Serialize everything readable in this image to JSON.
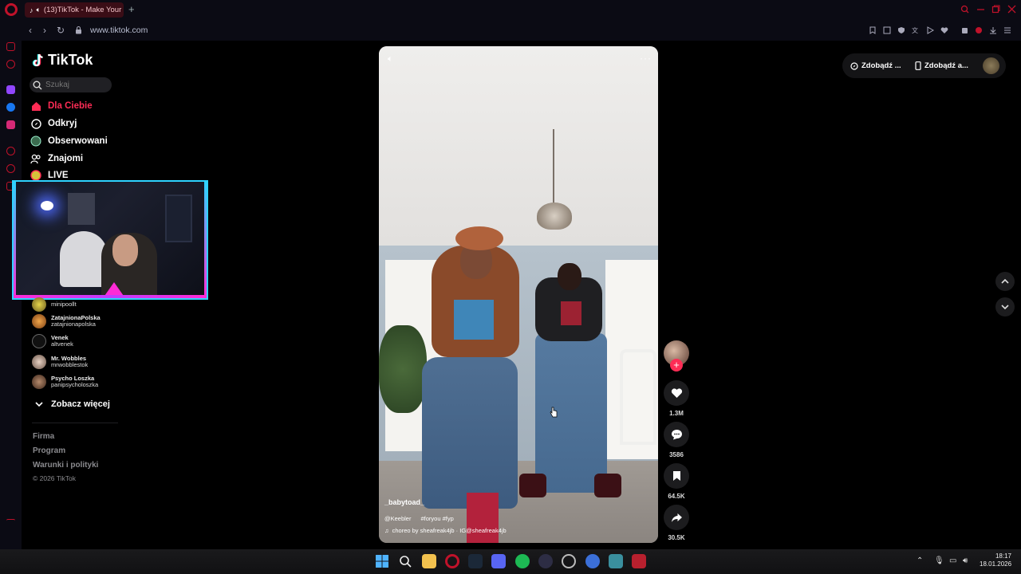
{
  "browser": {
    "tab_title": "(13)TikTok - Make Your",
    "new_tab": "+",
    "url": "www.tiktok.com"
  },
  "tiktok": {
    "logo_text": "TikTok",
    "search_placeholder": "Szukaj",
    "nav": [
      {
        "label": "Dla Ciebie",
        "icon": "home-icon",
        "active": true
      },
      {
        "label": "Odkryj",
        "icon": "compass-icon",
        "active": false
      },
      {
        "label": "Obserwowani",
        "icon": "following-avatar-icon",
        "active": false
      },
      {
        "label": "Znajomi",
        "icon": "friends-icon",
        "active": false
      },
      {
        "label": "LIVE",
        "icon": "live-icon",
        "active": false
      }
    ],
    "followed_accounts": [
      {
        "name": "",
        "username": "minipoollt"
      },
      {
        "name": "ZatajnionaPolska",
        "username": "zatajnionapolska"
      },
      {
        "name": "Venek",
        "username": "altvenek"
      },
      {
        "name": "Mr. Wobbles",
        "username": "mrwobblestok"
      },
      {
        "name": "Psycho Loszka",
        "username": "panipsycholoszka"
      }
    ],
    "see_more": "Zobacz więcej",
    "footer_links": [
      "Firma",
      "Program",
      "Warunki i polityki"
    ],
    "copyright": "© 2026 TikTok",
    "top_right": {
      "btn1": "Zdobądź ...",
      "btn2": "Zdobądź a..."
    },
    "video": {
      "author_watermark": "_babytoad_",
      "caption_user": "@Keebler",
      "caption_tags": "#foryou #fyp",
      "music": "choreo by sheafreak4jb · IG@sheafreak4jb"
    },
    "actions": {
      "likes": "1.3M",
      "comments": "3586",
      "saves": "64.5K",
      "shares": "30.5K"
    }
  },
  "taskbar": {
    "time": "18:17",
    "date": "18.01.2026"
  },
  "colors": {
    "accent": "#fe2c55",
    "background": "#000000",
    "tab_bg": "#3a0d16"
  }
}
